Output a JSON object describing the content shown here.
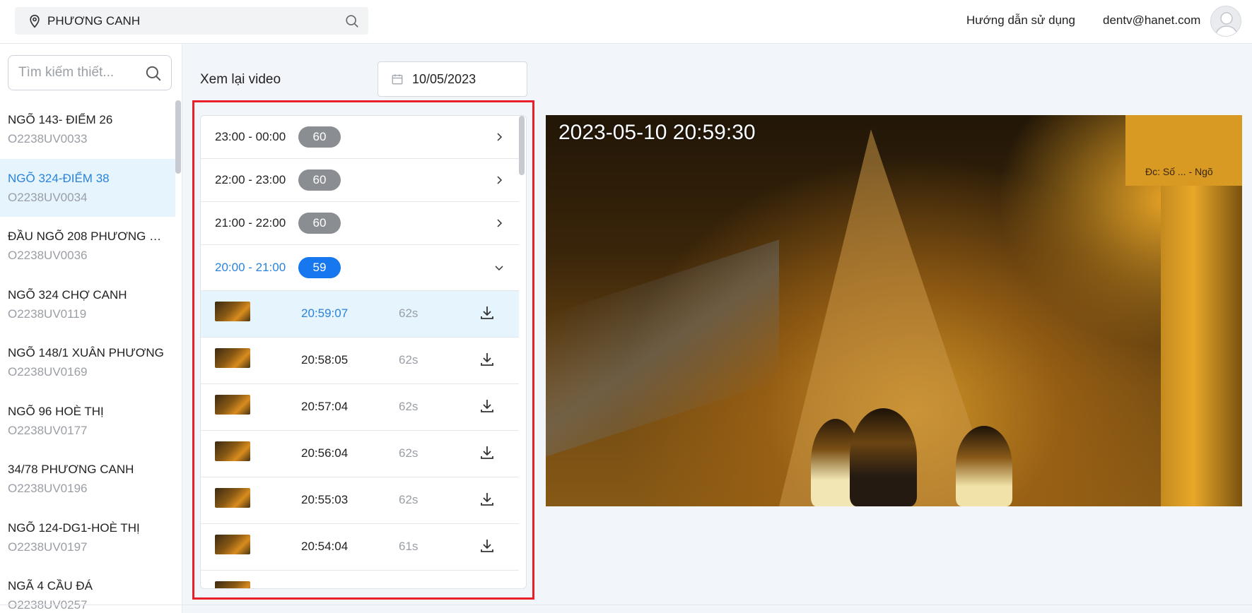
{
  "header": {
    "location": "PHƯƠNG CANH",
    "guide_link": "Hướng dẫn sử dụng",
    "user_email": "dentv@hanet.com"
  },
  "sidebar": {
    "search_placeholder": "Tìm kiếm thiết...",
    "devices": [
      {
        "name": "NGÕ 143- ĐIỂM 26",
        "code": "O2238UV0033",
        "active": false
      },
      {
        "name": "NGÕ 324-ĐIỂM 38",
        "code": "O2238UV0034",
        "active": true
      },
      {
        "name": "ĐẦU NGÕ 208 PHƯƠNG C...",
        "code": "O2238UV0036",
        "active": false
      },
      {
        "name": "NGÕ 324 CHỢ CANH",
        "code": "O2238UV0119",
        "active": false
      },
      {
        "name": "NGÕ 148/1 XUÂN PHƯƠNG",
        "code": "O2238UV0169",
        "active": false
      },
      {
        "name": "NGÕ 96 HOÈ THỊ",
        "code": "O2238UV0177",
        "active": false
      },
      {
        "name": "34/78 PHƯƠNG CANH",
        "code": "O2238UV0196",
        "active": false
      },
      {
        "name": "NGÕ 124-DG1-HOÈ THỊ",
        "code": "O2238UV0197",
        "active": false
      },
      {
        "name": "NGÃ 4 CẦU ĐÁ",
        "code": "O2238UV0257",
        "active": false
      }
    ]
  },
  "main": {
    "title": "Xem lại video",
    "date": "10/05/2023",
    "hours": [
      {
        "range": "23:00 - 00:00",
        "count": "60",
        "open": false
      },
      {
        "range": "22:00 - 23:00",
        "count": "60",
        "open": false
      },
      {
        "range": "21:00 - 22:00",
        "count": "60",
        "open": false
      },
      {
        "range": "20:00 - 21:00",
        "count": "59",
        "open": true
      }
    ],
    "clips": [
      {
        "time": "20:59:07",
        "duration": "62s",
        "active": true
      },
      {
        "time": "20:58:05",
        "duration": "62s",
        "active": false
      },
      {
        "time": "20:57:04",
        "duration": "62s",
        "active": false
      },
      {
        "time": "20:56:04",
        "duration": "62s",
        "active": false
      },
      {
        "time": "20:55:03",
        "duration": "62s",
        "active": false
      },
      {
        "time": "20:54:04",
        "duration": "61s",
        "active": false
      }
    ],
    "video": {
      "timestamp": "2023-05-10  20:59:30",
      "sign_text": "Đc: Số ... - Ngõ"
    }
  },
  "colors": {
    "accent": "#2a83d8",
    "badge_open": "#1677ef",
    "badge": "#8a8d91",
    "highlight_outline": "#e8202a",
    "active_bg": "#e6f4fd"
  }
}
